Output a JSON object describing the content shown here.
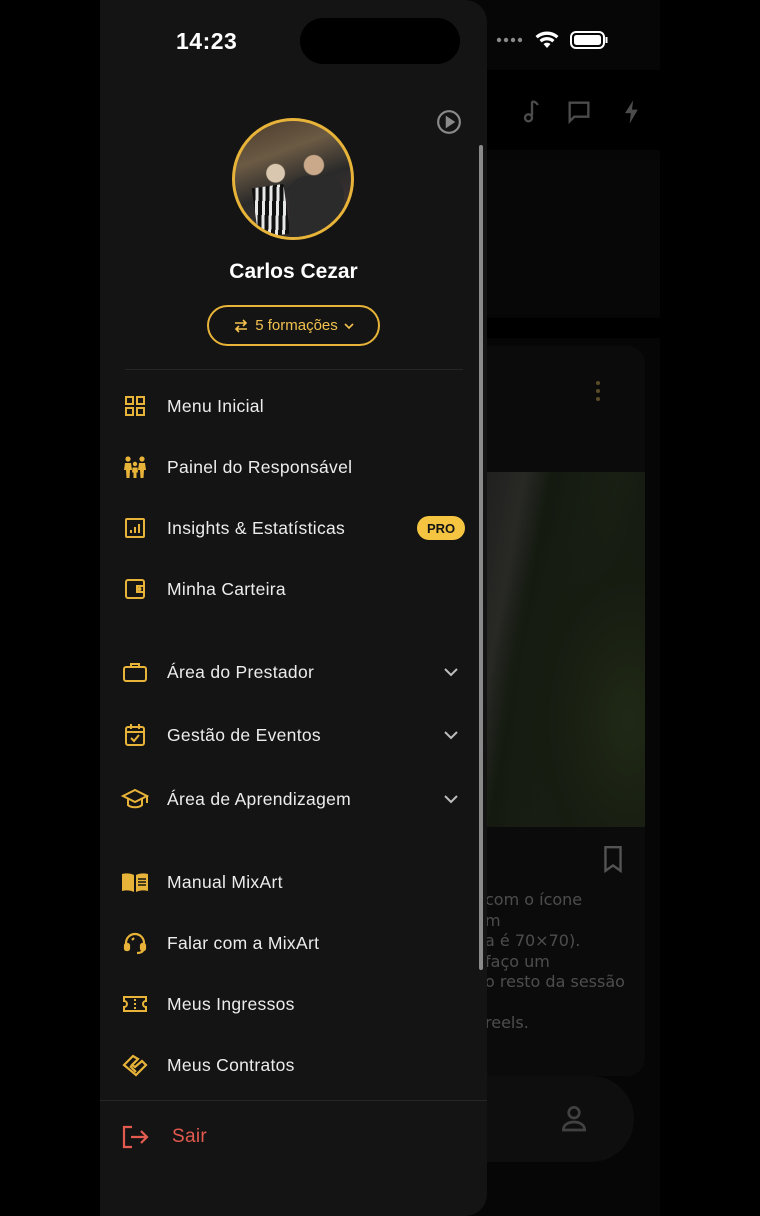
{
  "status_bar": {
    "time": "14:23"
  },
  "profile": {
    "name": "Carlos Cezar",
    "formacoes_label": "5 formações"
  },
  "menu": {
    "group1": [
      {
        "label": "Menu Inicial",
        "icon": "grid-icon"
      },
      {
        "label": "Painel do Responsável",
        "icon": "family-icon"
      },
      {
        "label": "Insights & Estatísticas",
        "icon": "chart-icon",
        "badge": "PRO"
      },
      {
        "label": "Minha Carteira",
        "icon": "wallet-icon"
      }
    ],
    "group2": [
      {
        "label": "Área do Prestador",
        "icon": "briefcase-icon"
      },
      {
        "label": "Gestão de Eventos",
        "icon": "calendar-check-icon"
      },
      {
        "label": "Área de Aprendizagem",
        "icon": "graduation-cap-icon"
      }
    ],
    "group3": [
      {
        "label": "Manual MixArt",
        "icon": "book-icon"
      },
      {
        "label": "Falar com a MixArt",
        "icon": "support-icon"
      },
      {
        "label": "Meus Ingressos",
        "icon": "ticket-icon"
      },
      {
        "label": "Meus Contratos",
        "icon": "handshake-icon"
      }
    ],
    "logout_label": "Sair"
  },
  "background": {
    "post_text": "com o ícone\nm\na é 70×70).\nfaço um\no resto da sessão\n\nreels."
  },
  "colors": {
    "accent": "#E8B339",
    "badge": "#F5C542",
    "logout": "#E35A4E",
    "drawer_bg": "#141414"
  }
}
